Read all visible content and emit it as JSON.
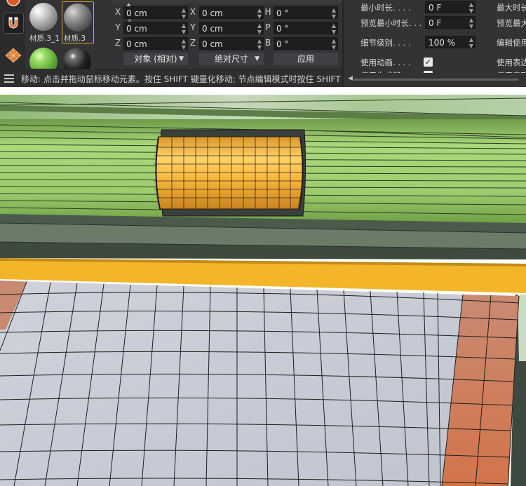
{
  "materials": [
    {
      "label": "",
      "name": "white-material"
    },
    {
      "label": "",
      "name": "gray-material"
    },
    {
      "label": "材质.3_1",
      "name": "green-material"
    },
    {
      "label": "材质.3",
      "name": "black-material"
    }
  ],
  "coordinates": {
    "position": [
      {
        "axis": "X",
        "value": "0 cm"
      },
      {
        "axis": "Y",
        "value": "0 cm"
      },
      {
        "axis": "Z",
        "value": "0 cm"
      }
    ],
    "size": [
      {
        "axis": "X",
        "value": "0 cm"
      },
      {
        "axis": "Y",
        "value": "0 cm"
      },
      {
        "axis": "Z",
        "value": "0 cm"
      }
    ],
    "rotation": [
      {
        "axis": "H",
        "value": "0 °"
      },
      {
        "axis": "P",
        "value": "0 °"
      },
      {
        "axis": "B",
        "value": "0 °"
      }
    ],
    "mode_dropdown": "对象 (相对)",
    "size_dropdown": "绝对尺寸",
    "apply_button": "应用"
  },
  "attributes": {
    "min_duration_label": "最小时长. . . .",
    "min_duration_value": "0 F",
    "max_duration_label": "最大时长",
    "preview_min_label": "预览最小时长. . .",
    "preview_min_value": "0 F",
    "preview_max_label": "预览最大",
    "detail_label": "细节级别. . . .",
    "detail_value": "100 %",
    "edit_use_label": "编辑使用",
    "use_animation_label": "使用动画. . . .",
    "use_animation_checked": true,
    "use_expression_label": "使用表达",
    "use_generator_label": "使用生成器",
    "use_deformer_label": "使用变形器"
  },
  "status_bar": {
    "text": "移动: 点击并拖动鼠标移动元素。按住 SHIFT 键量化移动; 节点编辑模式时按住 SHIFT 键增加"
  },
  "colors": {
    "panel_bg": "#333336",
    "field_bg": "#1e1e21",
    "accent_orange": "#e2a23a",
    "cylinder_yellow": "#f3b43a",
    "rail_green": "#9fd26e",
    "floor_blue_gray": "#c9ccd6",
    "floor_border_orange": "#d17a52"
  }
}
